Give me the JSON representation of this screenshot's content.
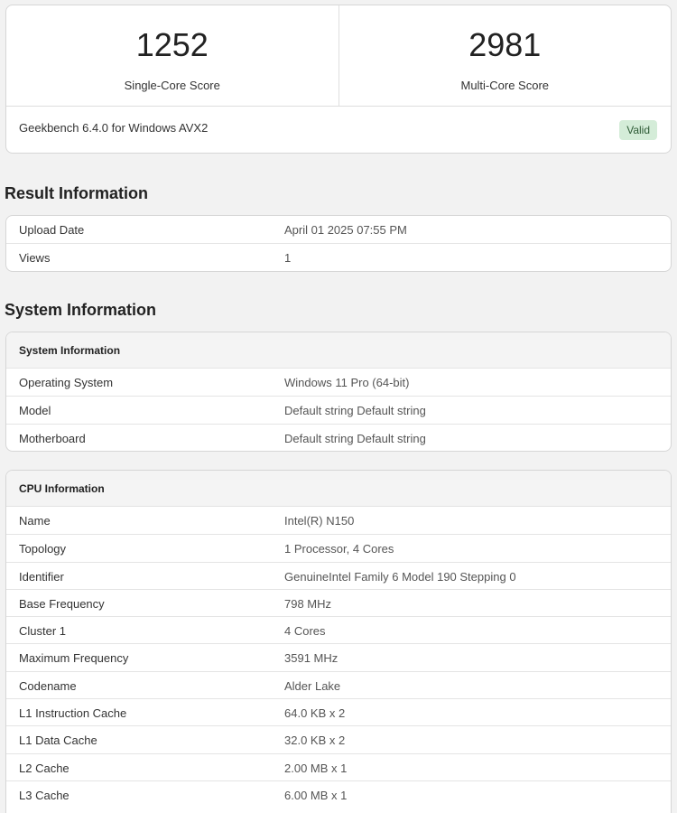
{
  "scores": {
    "single": {
      "value": "1252",
      "label": "Single-Core Score"
    },
    "multi": {
      "value": "2981",
      "label": "Multi-Core Score"
    },
    "version": "Geekbench 6.4.0 for Windows AVX2",
    "status": "Valid"
  },
  "result": {
    "title": "Result Information",
    "rows": [
      {
        "label": "Upload Date",
        "value": "April 01 2025 07:55 PM"
      },
      {
        "label": "Views",
        "value": "1"
      }
    ]
  },
  "system_section": {
    "title": "System Information"
  },
  "system": {
    "header": "System Information",
    "rows": [
      {
        "label": "Operating System",
        "value": "Windows 11 Pro (64-bit)"
      },
      {
        "label": "Model",
        "value": "Default string Default string"
      },
      {
        "label": "Motherboard",
        "value": "Default string Default string"
      }
    ]
  },
  "cpu": {
    "header": "CPU Information",
    "rows": [
      {
        "label": "Name",
        "value": "Intel(R) N150"
      },
      {
        "label": "Topology",
        "value": "1 Processor, 4 Cores"
      },
      {
        "label": "Identifier",
        "value": "GenuineIntel Family 6 Model 190 Stepping 0"
      },
      {
        "label": "Base Frequency",
        "value": "798 MHz"
      },
      {
        "label": "Cluster 1",
        "value": "4 Cores"
      },
      {
        "label": "Maximum Frequency",
        "value": "3591 MHz"
      },
      {
        "label": "Codename",
        "value": "Alder Lake"
      },
      {
        "label": "L1 Instruction Cache",
        "value": "64.0 KB x 2"
      },
      {
        "label": "L1 Data Cache",
        "value": "32.0 KB x 2"
      },
      {
        "label": "L2 Cache",
        "value": "2.00 MB x 1"
      },
      {
        "label": "L3 Cache",
        "value": "6.00 MB x 1"
      }
    ]
  }
}
